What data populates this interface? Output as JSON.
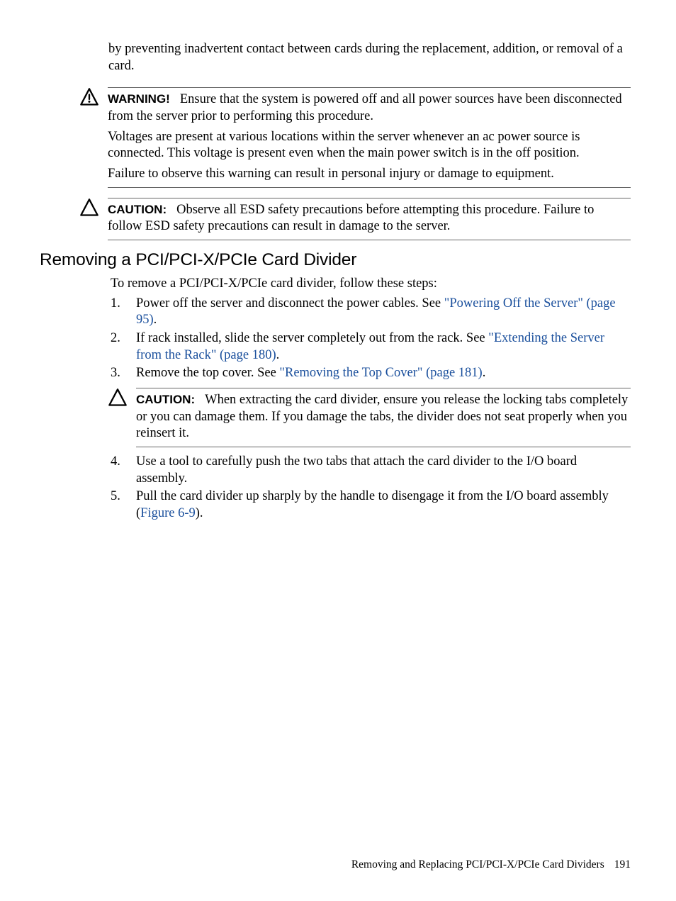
{
  "intro_para": "by preventing inadvertent contact between cards during the replacement, addition, or removal of a card.",
  "warning": {
    "label": "WARNING!",
    "p1": "Ensure that the system is powered off and all power sources have been disconnected from the server prior to performing this procedure.",
    "p2": "Voltages are present at various locations within the server whenever an ac power source is connected. This voltage is present even when the main power switch is in the off position.",
    "p3": "Failure to observe this warning can result in personal injury or damage to equipment."
  },
  "caution1": {
    "label": "CAUTION:",
    "p1": "Observe all ESD safety precautions before attempting this procedure. Failure to follow ESD safety precautions can result in damage to the server."
  },
  "section_heading": "Removing a PCI/PCI-X/PCIe Card Divider",
  "section_intro": "To remove a PCI/PCI-X/PCIe card divider, follow these steps:",
  "steps": {
    "s1_a": "Power off the server and disconnect the power cables. See ",
    "s1_link": "\"Powering Off the Server\" (page 95)",
    "s1_b": ".",
    "s2_a": "If rack installed, slide the server completely out from the rack. See ",
    "s2_link": "\"Extending the Server from the Rack\" (page 180)",
    "s2_b": ".",
    "s3_a": "Remove the top cover. See ",
    "s3_link": "\"Removing the Top Cover\" (page 181)",
    "s3_b": ".",
    "s4": "Use a tool to carefully push the two tabs that attach the card divider to the I/O board assembly.",
    "s5_a": "Pull the card divider up sharply by the handle to disengage it from the I/O board assembly (",
    "s5_link": "Figure 6-9",
    "s5_b": ")."
  },
  "caution2": {
    "label": "CAUTION:",
    "p1": "When extracting the card divider, ensure you release the locking tabs completely or you can damage them. If you damage the tabs, the divider does not seat properly when you reinsert it."
  },
  "footer": {
    "text": "Removing and Replacing PCI/PCI-X/PCIe Card Dividers",
    "page": "191"
  }
}
